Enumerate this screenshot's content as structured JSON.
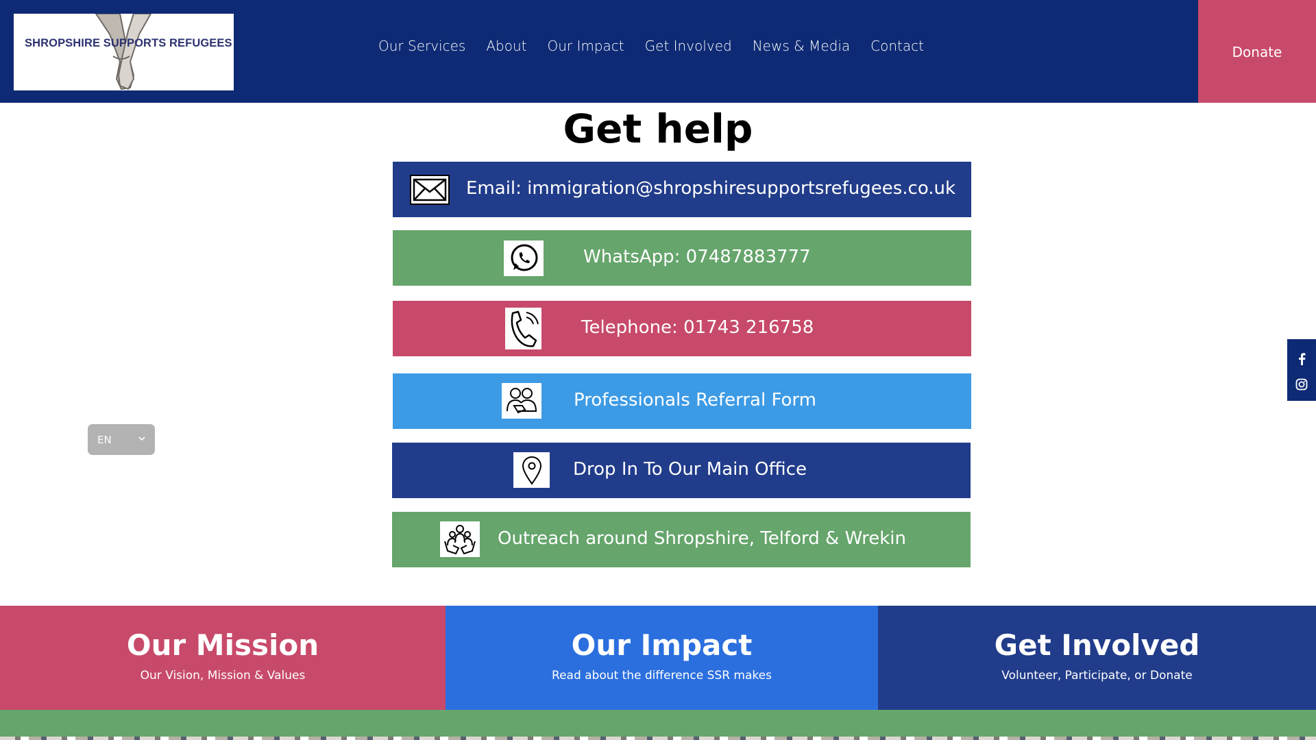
{
  "header": {
    "logo_text": "SHROPSHIRE SUPPORTS REFUGEES",
    "nav": [
      "Our Services",
      "About",
      "Our Impact",
      "Get Involved",
      "News & Media",
      "Contact"
    ],
    "donate_label": "Donate"
  },
  "page_title": "Get help",
  "contacts": [
    {
      "label": "Email: immigration@shropshiresupportsrefugees.co.uk",
      "icon": "envelope-icon",
      "color": "#213c8a"
    },
    {
      "label": "WhatsApp: 07487883777",
      "icon": "whatsapp-icon",
      "color": "#66a56c"
    },
    {
      "label": "Telephone: 01743 216758",
      "icon": "phone-icon",
      "color": "#c84a6a"
    },
    {
      "label": "Professionals Referral Form",
      "icon": "people-icon",
      "color": "#3d9be6"
    },
    {
      "label": "Drop In To Our Main Office",
      "icon": "location-pin-icon",
      "color": "#213c8a"
    },
    {
      "label": "Outreach around Shropshire, Telford & Wrekin",
      "icon": "family-hands-icon",
      "color": "#66a56c"
    }
  ],
  "language": {
    "current": "EN"
  },
  "social": [
    "facebook-icon",
    "instagram-icon"
  ],
  "panels": [
    {
      "title": "Our Mission",
      "subtitle": "Our Vision, Mission & Values",
      "color": "#c84a6a"
    },
    {
      "title": "Our Impact",
      "subtitle": "Read about the difference SSR makes",
      "color": "#2b6fde"
    },
    {
      "title": "Get Involved",
      "subtitle": "Volunteer, Participate, or Donate",
      "color": "#213c8a"
    }
  ]
}
